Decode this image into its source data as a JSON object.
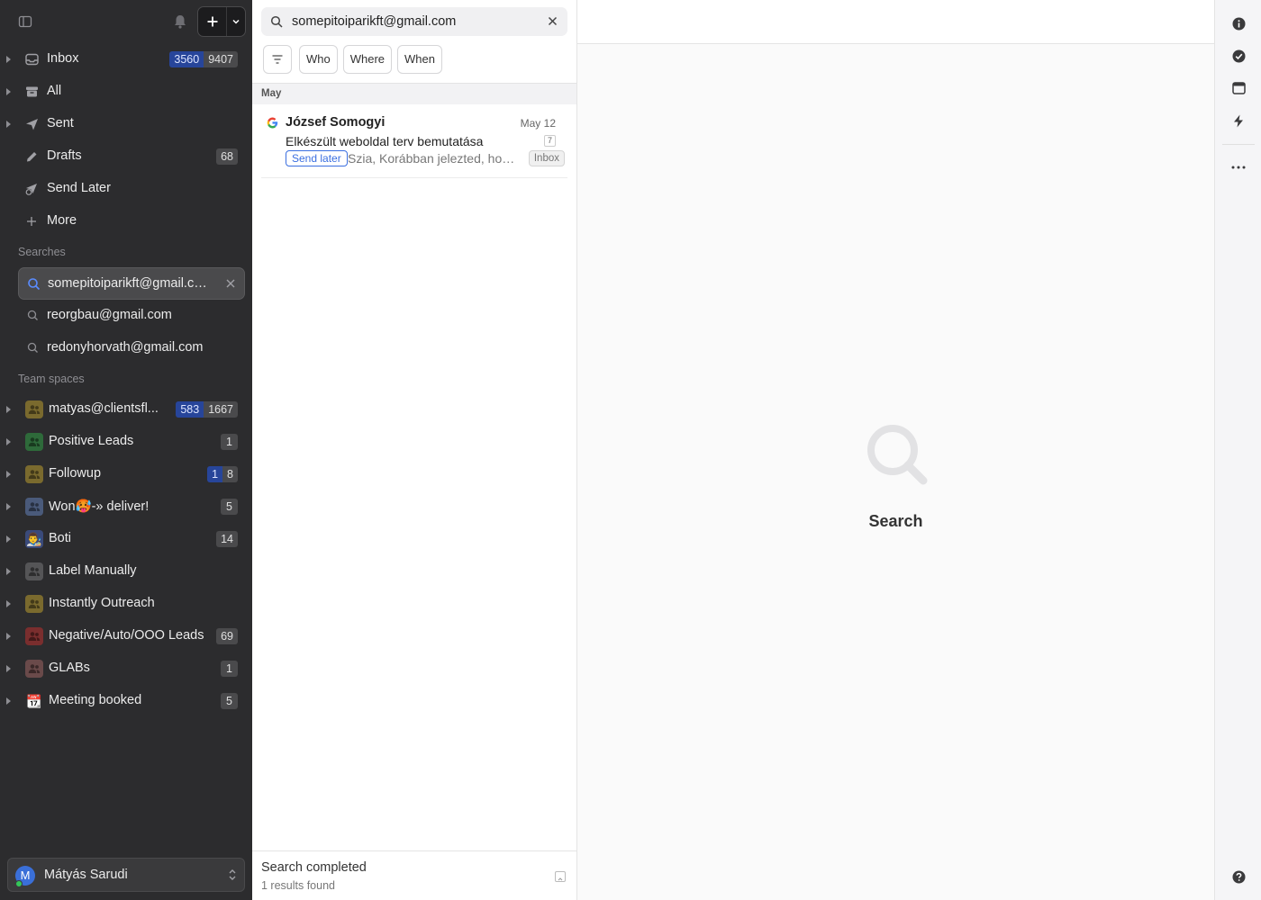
{
  "sidebar": {
    "nav": [
      {
        "label": "Inbox",
        "icon": "inbox-icon",
        "unread": "3560",
        "total": "9407"
      },
      {
        "label": "All",
        "icon": "archive-icon"
      },
      {
        "label": "Sent",
        "icon": "send-icon"
      },
      {
        "label": "Drafts",
        "icon": "pencil-icon",
        "count": "68"
      },
      {
        "label": "Send Later",
        "icon": "send-later-icon"
      },
      {
        "label": "More",
        "icon": "plus-icon"
      }
    ],
    "searches_title": "Searches",
    "searches": [
      {
        "label": "somepitoiparikft@gmail.com",
        "active": true
      },
      {
        "label": "reorgbau@gmail.com"
      },
      {
        "label": "redonyhorvath@gmail.com"
      }
    ],
    "teams_title": "Team spaces",
    "teams": [
      {
        "label": "matyas@clientsfl...",
        "avatar_color": "#7a6a2e",
        "unread": "583",
        "total": "1667"
      },
      {
        "label": "Positive Leads",
        "avatar_color": "#2e6a3a",
        "count": "1"
      },
      {
        "label": "Followup",
        "avatar_color": "#7a6a2e",
        "unread": "1",
        "total": "8"
      },
      {
        "label": "Won🥵-» deliver!",
        "avatar_color": "#4a5a7a",
        "count": "5"
      },
      {
        "label": "Boti",
        "avatar_color": "#3a4a7a",
        "avatar_emoji": "👨‍🎨",
        "count": "14"
      },
      {
        "label": "Label Manually",
        "avatar_color": "#555557",
        "count": ""
      },
      {
        "label": "Instantly Outreach",
        "avatar_color": "#7a6a2e",
        "count": ""
      },
      {
        "label": "Negative/Auto/OOO Leads",
        "avatar_color": "#7a2e2e",
        "count": "69"
      },
      {
        "label": "GLABs",
        "avatar_color": "#6a4a4a",
        "count": "1"
      },
      {
        "label": "Meeting booked",
        "avatar_color": "#2c2c2e",
        "avatar_emoji": "📆",
        "count": "5"
      }
    ],
    "user": {
      "initial": "M",
      "name": "Mátyás Sarudi"
    }
  },
  "list": {
    "search_value": "somepitoiparikft@gmail.com",
    "filters": [
      "Who",
      "Where",
      "When"
    ],
    "group": "May",
    "messages": [
      {
        "sender": "József Somogyi",
        "date": "May 12",
        "subject": "Elkészült weboldal terv bemutatása",
        "thread_count": "7",
        "tag": "Send later",
        "snippet": "Szia, Korábban jelezted, hogy...",
        "folder": "Inbox"
      }
    ],
    "status": "Search completed",
    "results": "1 results found"
  },
  "main": {
    "empty_label": "Search"
  },
  "colors": {
    "sidebar_bg": "#2c2c2e",
    "accent_blue": "#3b6fe0",
    "badge_blue": "#27459a"
  }
}
